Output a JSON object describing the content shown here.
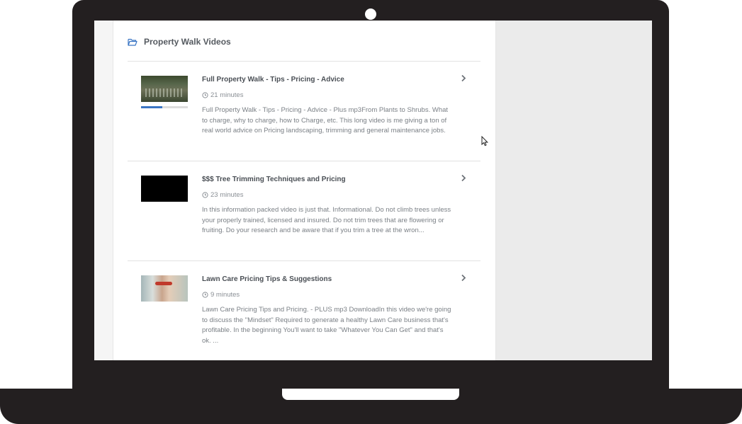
{
  "header": {
    "title": "Property Walk Videos",
    "icon": "folder-open-icon"
  },
  "videos": [
    {
      "title": "Full Property Walk - Tips - Pricing - Advice",
      "duration": "21 minutes",
      "description": "Full Property Walk - Tips - Pricing - Advice - Plus mp3From Plants to Shrubs. What to charge, why to charge, how to Charge, etc. This long video is me giving a ton of real world advice on Pricing landscaping, trimming and general maintenance jobs.",
      "progress": 0.45
    },
    {
      "title": "$$$ Tree Trimming Techniques and Pricing",
      "duration": "23 minutes",
      "description": "In this information packed video is just that. Informational. Do not climb trees unless your properly trained, licensed and insured. Do not trim trees that are flowering or fruiting.  Do your research and be aware that if you trim a tree at the wron..."
    },
    {
      "title": "Lawn Care Pricing Tips & Suggestions",
      "duration": "9 minutes",
      "description": "Lawn Care Pricing Tips and Pricing. - PLUS mp3 DownloadIn this video we're going to discuss the \"Mindset\" Required to generate a healthy Lawn Care business that's profitable. In the beginning You'll want to take \"Whatever You Can Get\" and that's ok. ..."
    }
  ],
  "colors": {
    "accent": "#3a75c4",
    "frame": "#231f20",
    "title_text": "#4a4f55",
    "body_text": "#7b8086"
  }
}
